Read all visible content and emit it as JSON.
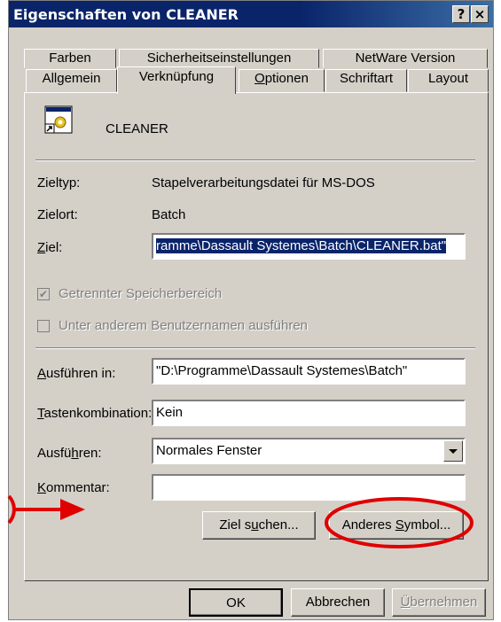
{
  "window": {
    "title": "Eigenschaften von CLEANER",
    "help_btn": "?",
    "close_btn": "×"
  },
  "tabs": {
    "row1": [
      "Farben",
      "Sicherheitseinstellungen",
      "NetWare Version"
    ],
    "row2": [
      "Allgemein",
      "Verknüpfung",
      "Optionen",
      "Schriftart",
      "Layout"
    ],
    "active": "Verknüpfung"
  },
  "shortcut": {
    "name": "CLEANER",
    "target_type_label": "Zieltyp:",
    "target_type_value": "Stapelverarbeitungsdatei für MS-DOS",
    "target_location_label": "Zielort:",
    "target_location_value": "Batch",
    "target_label": "Ziel:",
    "target_value": "ramme\\Dassault Systemes\\Batch\\CLEANER.bat\"",
    "separate_memory_label": "Getrennter Speicherbereich",
    "separate_memory_checked": true,
    "run_as_label": "Unter anderem Benutzernamen ausführen",
    "run_as_checked": false,
    "start_in_label": "Ausführen in:",
    "start_in_value": "\"D:\\Programme\\Dassault Systemes\\Batch\"",
    "hotkey_label": "Tastenkombination:",
    "hotkey_value": "Kein",
    "run_label": "Ausführen:",
    "run_value": "Normales Fenster",
    "comment_label": "Kommentar:",
    "comment_value": "",
    "find_target_btn": "Ziel suchen...",
    "change_icon_btn": "Anderes Symbol..."
  },
  "footer": {
    "ok": "OK",
    "cancel": "Abbrechen",
    "apply": "Übernehmen"
  },
  "annotation_color": "#e00000"
}
